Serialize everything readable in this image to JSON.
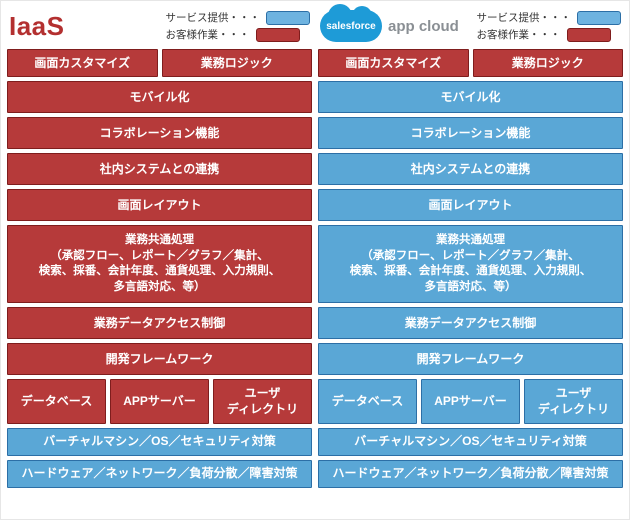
{
  "legend": {
    "provider": "サービス提供・・・",
    "customer": "お客様作業・・・"
  },
  "left": {
    "title": "IaaS",
    "layers": {
      "screenCustomize": "画面カスタマイズ",
      "businessLogic": "業務ロジック",
      "mobile": "モバイル化",
      "collab": "コラボレーション機能",
      "integration": "社内システムとの連携",
      "layout": "画面レイアウト",
      "common": "業務共通処理\n（承認フロー、レポート／グラフ／集計、\n検索、採番、会計年度、通貨処理、入力規則、\n多言語対応、等）",
      "access": "業務データアクセス制御",
      "framework": "開発フレームワーク",
      "db": "データベース",
      "app": "APPサーバー",
      "userdir": "ユーザ\nディレクトリ",
      "vm": "バーチャルマシン／OS／セキュリティ対策",
      "hw": "ハードウェア／ネットワーク／負荷分散／障害対策"
    }
  },
  "right": {
    "brand": "salesforce",
    "brandSuffix": "app cloud",
    "layers": {
      "screenCustomize": "画面カスタマイズ",
      "businessLogic": "業務ロジック",
      "mobile": "モバイル化",
      "collab": "コラボレーション機能",
      "integration": "社内システムとの連携",
      "layout": "画面レイアウト",
      "common": "業務共通処理\n（承認フロー、レポート／グラフ／集計、\n検索、採番、会計年度、通貨処理、入力規則、\n多言語対応、等）",
      "access": "業務データアクセス制御",
      "framework": "開発フレームワーク",
      "db": "データベース",
      "app": "APPサーバー",
      "userdir": "ユーザ\nディレクトリ",
      "vm": "バーチャルマシン／OS／セキュリティ対策",
      "hw": "ハードウェア／ネットワーク／負荷分散／障害対策"
    }
  },
  "colors": {
    "blue": "#5aa7d6",
    "blueBorder": "#2c6fa6",
    "red": "#b63a3a",
    "redBorder": "#7f1d1d"
  },
  "chart_data": {
    "type": "table",
    "title": "IaaS vs Salesforce App Cloud — responsibility split",
    "legend": {
      "provider": "サービス提供 (blue)",
      "customer": "お客様作業 (red)"
    },
    "layers": [
      "画面カスタマイズ",
      "業務ロジック",
      "モバイル化",
      "コラボレーション機能",
      "社内システムとの連携",
      "画面レイアウト",
      "業務共通処理",
      "業務データアクセス制御",
      "開発フレームワーク",
      "データベース",
      "APPサーバー",
      "ユーザディレクトリ",
      "バーチャルマシン／OS／セキュリティ対策",
      "ハードウェア／ネットワーク／負荷分散／障害対策"
    ],
    "series": [
      {
        "name": "IaaS",
        "values": [
          "customer",
          "customer",
          "customer",
          "customer",
          "customer",
          "customer",
          "customer",
          "customer",
          "customer",
          "customer",
          "customer",
          "customer",
          "provider",
          "provider"
        ]
      },
      {
        "name": "Salesforce App Cloud",
        "values": [
          "customer",
          "customer",
          "provider",
          "provider",
          "provider",
          "provider",
          "provider",
          "provider",
          "provider",
          "provider",
          "provider",
          "provider",
          "provider",
          "provider"
        ]
      }
    ]
  }
}
